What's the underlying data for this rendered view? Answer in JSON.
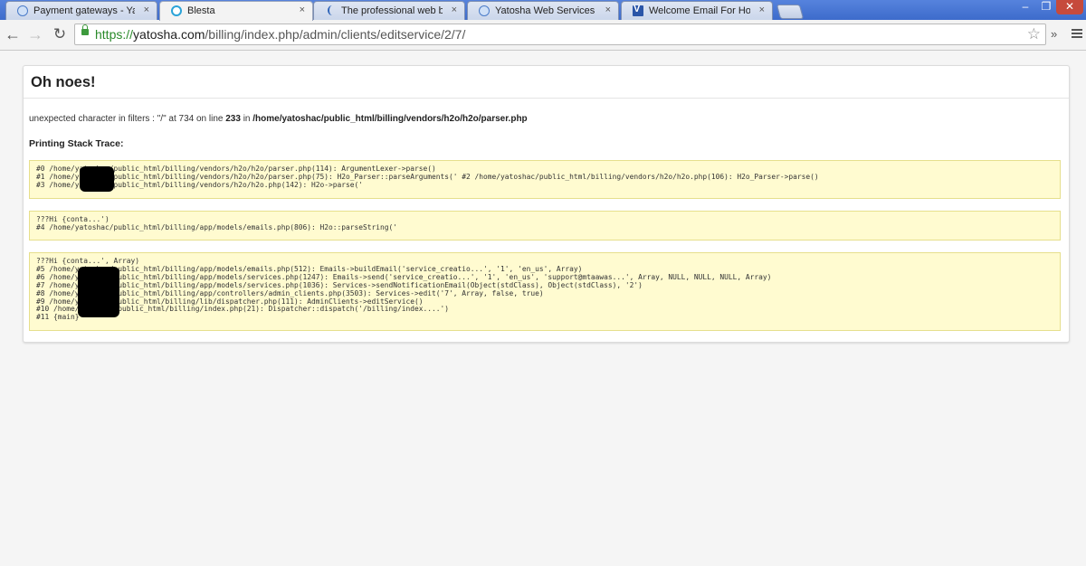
{
  "browser": {
    "tabs": [
      {
        "title": "Payment gateways - Yato",
        "icon": "globe-icon",
        "close": "×"
      },
      {
        "title": "Blesta",
        "icon": "blesta-icon",
        "close": "×",
        "active": true
      },
      {
        "title": "The professional web base",
        "icon": "wordpress-icon",
        "close": "×"
      },
      {
        "title": "Yatosha Web Services | Ta",
        "icon": "globe-icon",
        "close": "×"
      },
      {
        "title": "Welcome Email For Hostin",
        "icon": "v-icon",
        "close": "×"
      }
    ],
    "window_controls": {
      "minimize": "–",
      "maximize": "❐",
      "close": "✕"
    },
    "nav": {
      "back": "←",
      "forward": "→",
      "reload": "↻"
    },
    "url": {
      "scheme": "https://",
      "host": "yatosha.com",
      "path": "/billing/index.php/admin/clients/editservice/2/7/"
    },
    "star": "☆",
    "extensions_more": "»"
  },
  "page": {
    "title": "Oh noes!",
    "error_message": {
      "text": "unexpected character in filters : \"/\" at 734 on line ",
      "line": "233",
      "in_word": " in ",
      "file": "/home/yatoshac/public_html/billing/vendors/h2o/h2o/parser.php"
    },
    "stack_heading": "Printing Stack Trace:",
    "trace_blocks": [
      "#0 /home/yatoshac/public_html/billing/vendors/h2o/h2o/parser.php(114): ArgumentLexer->parse()\n#1 /home/yatoshac/public_html/billing/vendors/h2o/h2o/parser.php(75): H2o_Parser::parseArguments(' #2 /home/yatoshac/public_html/billing/vendors/h2o/h2o.php(106): H2o_Parser->parse()\n#3 /home/yatoshac/public_html/billing/vendors/h2o/h2o.php(142): H2o->parse('",
      "???Hi {conta...')\n#4 /home/yatoshac/public_html/billing/app/models/emails.php(806): H2o::parseString('",
      "???Hi {conta...', Array)\n#5 /home/yatoshac/public_html/billing/app/models/emails.php(512): Emails->buildEmail('service_creatio...', '1', 'en_us', Array)\n#6 /home/yatoshac/public_html/billing/app/models/services.php(1247): Emails->send('service_creatio...', '1', 'en_us', 'support@mtaawas...', Array, NULL, NULL, NULL, Array)\n#7 /home/yatoshac/public_html/billing/app/models/services.php(1036): Services->sendNotificationEmail(Object(stdClass), Object(stdClass), '2')\n#8 /home/yatoshac/public_html/billing/app/controllers/admin_clients.php(3503): Services->edit('7', Array, false, true)\n#9 /home/yatoshac/public_html/billing/lib/dispatcher.php(111): AdminClients->editService()\n#10 /home/yatoshac/public_html/billing/index.php(21): Dispatcher::dispatch('/billing/index....')\n#11 {main}"
    ]
  }
}
